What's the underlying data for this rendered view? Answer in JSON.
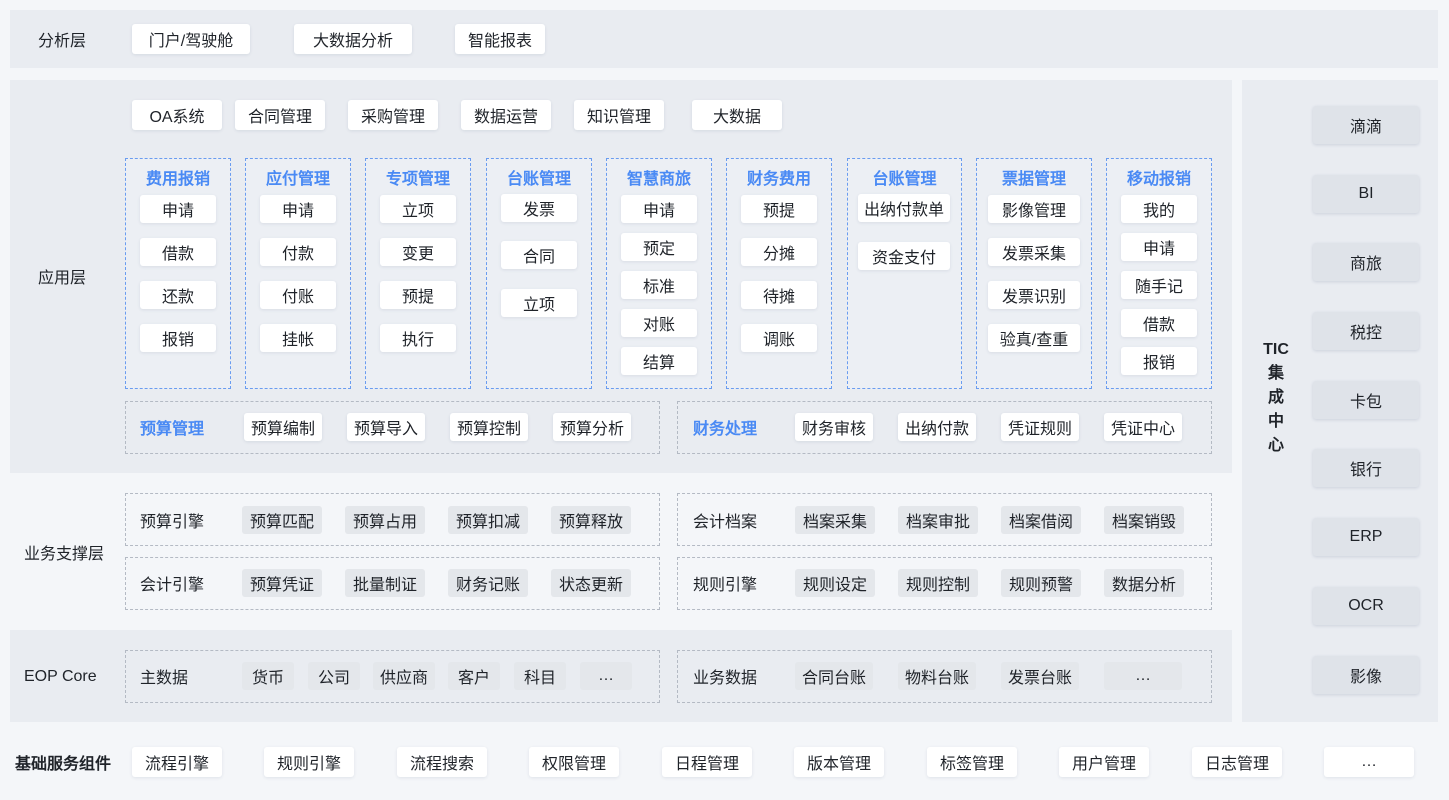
{
  "analysis": {
    "label": "分析层",
    "items": [
      "门户/驾驶舱",
      "大数据分析",
      "智能报表"
    ]
  },
  "app": {
    "label": "应用层",
    "top_items": [
      "OA系统",
      "合同管理",
      "采购管理",
      "数据运营",
      "知识管理",
      "大数据"
    ],
    "columns": [
      {
        "title": "费用报销",
        "items": [
          "申请",
          "借款",
          "还款",
          "报销"
        ]
      },
      {
        "title": "应付管理",
        "items": [
          "申请",
          "付款",
          "付账",
          "挂帐"
        ]
      },
      {
        "title": "专项管理",
        "items": [
          "立项",
          "变更",
          "预提",
          "执行"
        ]
      },
      {
        "title": "台账管理",
        "items": [
          "发票",
          "合同",
          "立项"
        ]
      },
      {
        "title": "智慧商旅",
        "items": [
          "申请",
          "预定",
          "标准",
          "对账",
          "结算"
        ]
      },
      {
        "title": "财务费用",
        "items": [
          "预提",
          "分摊",
          "待摊",
          "调账"
        ]
      },
      {
        "title": "台账管理",
        "items": [
          "出纳付款单",
          "资金支付"
        ]
      },
      {
        "title": "票据管理",
        "items": [
          "影像管理",
          "发票采集",
          "发票识别",
          "验真/查重"
        ]
      },
      {
        "title": "移动报销",
        "items": [
          "我的",
          "申请",
          "随手记",
          "借款",
          "报销"
        ]
      }
    ],
    "budget": {
      "title": "预算管理",
      "items": [
        "预算编制",
        "预算导入",
        "预算控制",
        "预算分析"
      ]
    },
    "finance": {
      "title": "财务处理",
      "items": [
        "财务审核",
        "出纳付款",
        "凭证规则",
        "凭证中心"
      ]
    }
  },
  "support": {
    "label": "业务支撑层",
    "rows": [
      {
        "title": "预算引擎",
        "items": [
          "预算匹配",
          "预算占用",
          "预算扣减",
          "预算释放"
        ]
      },
      {
        "title": "会计档案",
        "items": [
          "档案采集",
          "档案审批",
          "档案借阅",
          "档案销毁"
        ]
      },
      {
        "title": "会计引擎",
        "items": [
          "预算凭证",
          "批量制证",
          "财务记账",
          "状态更新"
        ]
      },
      {
        "title": "规则引擎",
        "items": [
          "规则设定",
          "规则控制",
          "规则预警",
          "数据分析"
        ]
      }
    ]
  },
  "core": {
    "label": "EOP Core",
    "master": {
      "title": "主数据",
      "items": [
        "货币",
        "公司",
        "供应商",
        "客户",
        "科目",
        "…"
      ]
    },
    "business": {
      "title": "业务数据",
      "items": [
        "合同台账",
        "物料台账",
        "发票台账",
        "…"
      ]
    }
  },
  "tic": {
    "title_chars": [
      "TIC",
      "集",
      "成",
      "中",
      "心"
    ],
    "items": [
      "滴滴",
      "BI",
      "商旅",
      "税控",
      "卡包",
      "银行",
      "ERP",
      "OCR",
      "影像"
    ]
  },
  "base": {
    "label": "基础服务组件",
    "items": [
      "流程引擎",
      "规则引擎",
      "流程搜索",
      "权限管理",
      "日程管理",
      "版本管理",
      "标签管理",
      "用户管理",
      "日志管理",
      "…"
    ]
  },
  "colors": {
    "accent": "#4a8af4",
    "panel": "#e9ecf1",
    "chip": "#ffffff",
    "grey_chip": "#e4e7eb"
  }
}
